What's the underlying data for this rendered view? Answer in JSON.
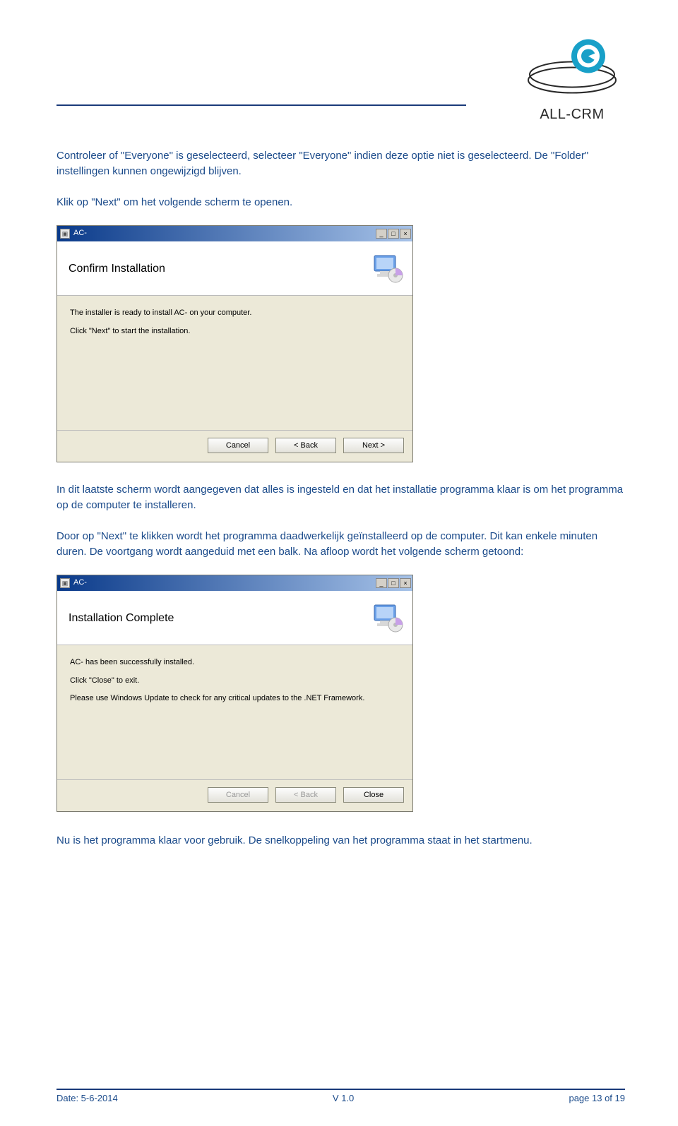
{
  "logo": {
    "label": "ALL-CRM"
  },
  "paragraphs": {
    "p1": "Controleer of \"Everyone\" is geselecteerd, selecteer \"Everyone\" indien deze optie niet is geselecteerd. De \"Folder\" instellingen kunnen ongewijzigd blijven.",
    "p2": "Klik op \"Next\" om het volgende scherm te openen.",
    "p3": "In dit laatste scherm wordt aangegeven dat alles is ingesteld en dat het installatie programma klaar is om het programma op de computer te installeren.",
    "p4": "Door op \"Next\" te klikken wordt het programma daadwerkelijk geïnstalleerd op de computer. Dit kan enkele minuten duren. De voortgang wordt aangeduid met een balk. Na afloop wordt het volgende scherm getoond:",
    "p5": "Nu is het programma klaar voor gebruik. De snelkoppeling van het programma staat in het startmenu."
  },
  "installer1": {
    "title": "AC-",
    "banner_title": "Confirm Installation",
    "line1": "The installer is ready to install AC- on your computer.",
    "line2": "Click \"Next\" to start the installation.",
    "buttons": {
      "cancel": "Cancel",
      "back": "< Back",
      "next": "Next >"
    }
  },
  "installer2": {
    "title": "AC-",
    "banner_title": "Installation Complete",
    "line1": "AC- has been successfully installed.",
    "line2": "Click \"Close\" to exit.",
    "line3": "Please use Windows Update to check for any critical updates to the .NET Framework.",
    "buttons": {
      "cancel": "Cancel",
      "back": "< Back",
      "close": "Close"
    }
  },
  "win_controls": {
    "min": "_",
    "max": "□",
    "close": "×"
  },
  "footer": {
    "date": "Date: 5-6-2014",
    "version": "V 1.0",
    "page": "page 13 of 19"
  }
}
